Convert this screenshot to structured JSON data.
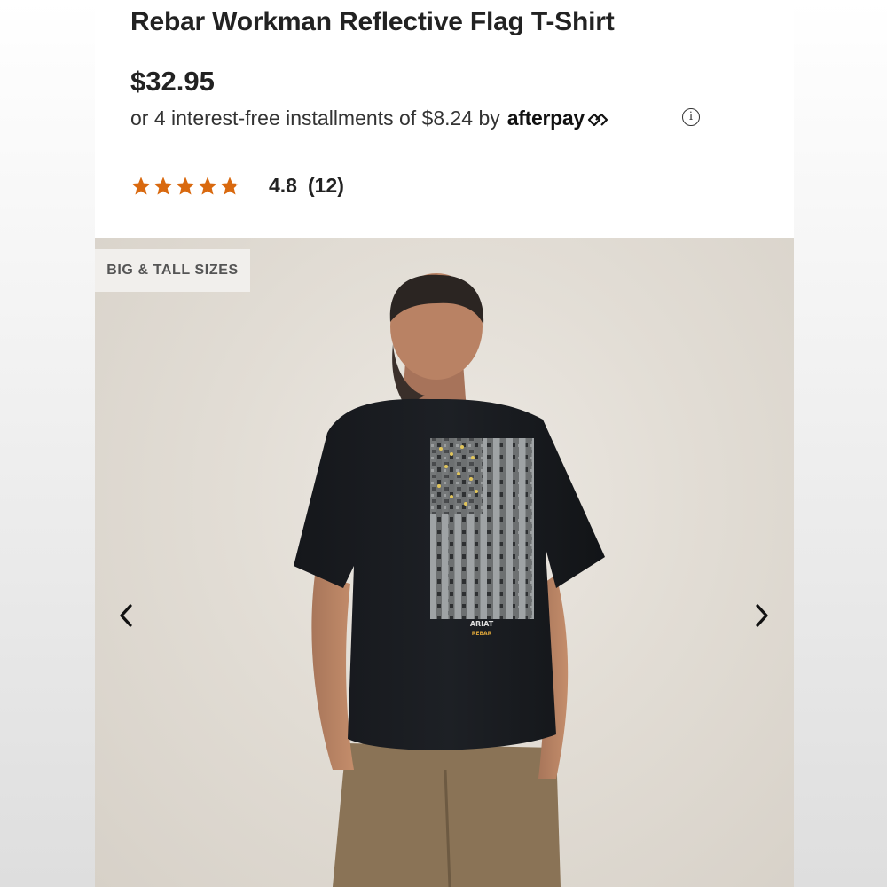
{
  "product": {
    "title": "Rebar Workman Reflective Flag T-Shirt",
    "price": "$32.95",
    "installments_text": "or 4 interest-free installments of $8.24 by",
    "afterpay_label": "afterpay",
    "info_symbol": "i",
    "rating_value": "4.8",
    "review_count": "(12)",
    "stars": 4.8,
    "star_color": "#d9690f"
  },
  "gallery": {
    "badge": "BIG & TALL SIZES",
    "print_brand": "ARIAT",
    "print_sub": "REBAR",
    "prev_icon": "chevron-left-icon",
    "next_icon": "chevron-right-icon"
  }
}
